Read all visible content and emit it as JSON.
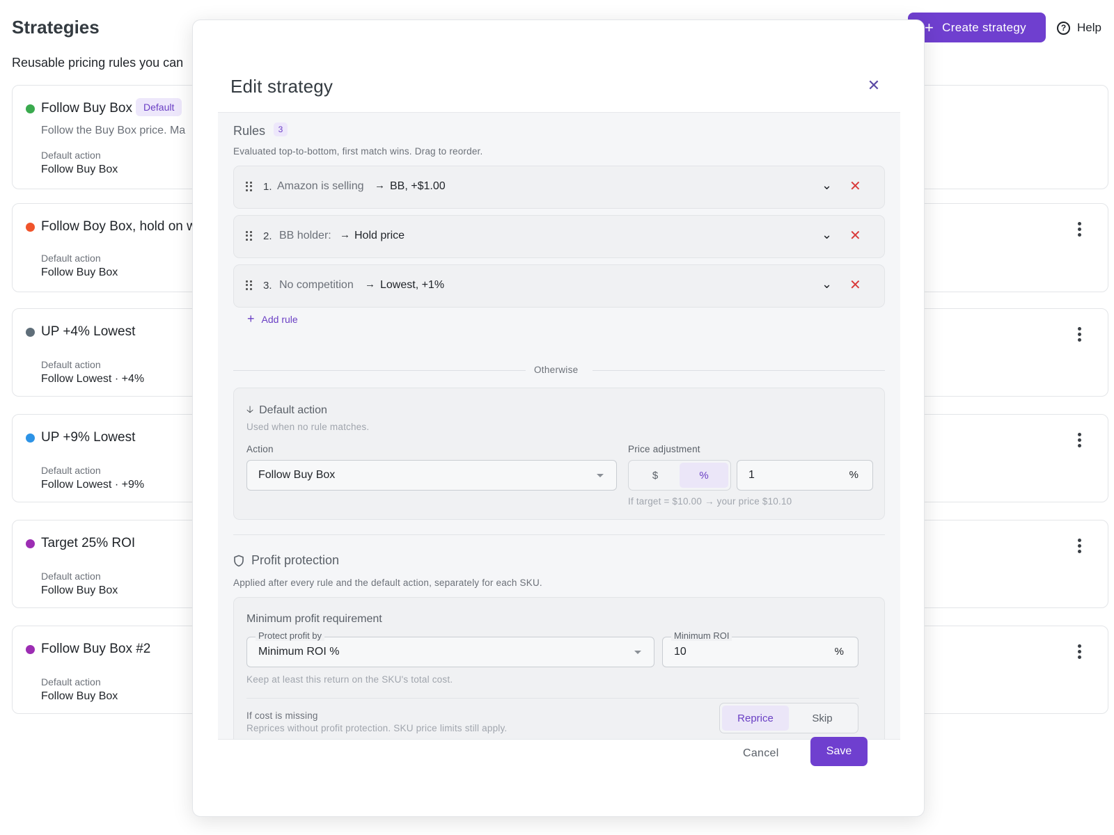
{
  "page": {
    "title": "Strategies",
    "subtitle": "Reusable pricing rules you can",
    "create_button": "Create strategy",
    "help_button": "Help",
    "default_action_label": "Default action"
  },
  "strategies": [
    {
      "name": "Follow Buy Box",
      "badge": "Default",
      "description": "Follow the Buy Box price. Ma",
      "default_action": "Follow Buy Box",
      "color": "#3aaa4e"
    },
    {
      "name": "Follow Boy Box, hold on w",
      "default_action": "Follow Buy Box",
      "color": "#f0542b"
    },
    {
      "name": "UP +4% Lowest",
      "default_action": "Follow Lowest · +4%",
      "color": "#5f6e79"
    },
    {
      "name": "UP +9% Lowest",
      "default_action": "Follow Lowest · +9%",
      "color": "#2d93e6"
    },
    {
      "name": "Target 25% ROI",
      "default_action": "Follow Buy Box",
      "color": "#9c2db3"
    },
    {
      "name": "Follow Buy Box #2",
      "default_action": "Follow Buy Box",
      "color": "#9c2db3"
    }
  ],
  "modal": {
    "title": "Edit strategy",
    "rules_title": "Rules",
    "rules_count": "3",
    "rules_hint": "Evaluated top-to-bottom, first match wins. Drag to reorder.",
    "rules": [
      {
        "num": "1.",
        "condition": "Amazon is selling",
        "result": "BB, +$1.00"
      },
      {
        "num": "2.",
        "condition": "BB holder:",
        "result": "Hold price"
      },
      {
        "num": "3.",
        "condition": "No competition",
        "result": "Lowest, +1%"
      }
    ],
    "add_rule": "Add rule",
    "otherwise": "Otherwise",
    "default_action": {
      "title": "Default action",
      "hint": "Used when no rule matches.",
      "action_label": "Action",
      "action_value": "Follow Buy Box",
      "price_label": "Price adjustment",
      "seg_dollar": "$",
      "seg_percent": "%",
      "price_value": "1",
      "price_unit": "%",
      "preview": "If target = $10.00 → your price $10.10"
    },
    "profit": {
      "title": "Profit protection",
      "hint": "Applied after every rule and the default action, separately for each SKU.",
      "box_title": "Minimum profit requirement",
      "protect_label": "Protect profit by",
      "protect_value": "Minimum ROI %",
      "roi_label": "Minimum ROI",
      "roi_value": "10",
      "roi_unit": "%",
      "roi_hint": "Keep at least this return on the SKU's total cost.",
      "missing_title": "If cost is missing",
      "missing_hint": "Reprices without profit protection. SKU price limits still apply.",
      "opt_reprice": "Reprice",
      "opt_skip": "Skip"
    },
    "cancel": "Cancel",
    "save": "Save"
  }
}
